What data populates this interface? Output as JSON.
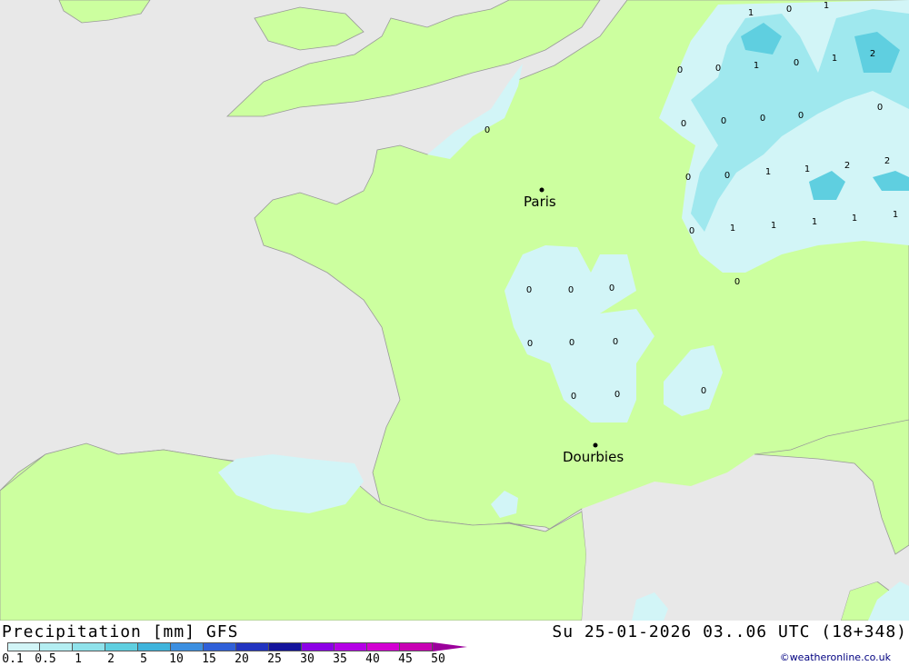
{
  "map": {
    "colors": {
      "sea": "#e8e8e8",
      "land": "#ccff9f",
      "precip_light": "#d2f5f7",
      "precip_mid": "#9fe8ee",
      "precip_heavy": "#5fcfe0",
      "border": "#999999"
    },
    "cities": [
      {
        "name": "Paris"
      },
      {
        "name": "Dourbies"
      }
    ],
    "values": [
      "1",
      "0",
      "1",
      "1",
      "0",
      "1",
      "0",
      "2",
      "0",
      "0",
      "0",
      "0",
      "0",
      "0",
      "0",
      "1",
      "1",
      "2",
      "2",
      "0",
      "1",
      "1",
      "1",
      "1",
      "1",
      "0",
      "0",
      "0",
      "0",
      "0",
      "0",
      "0",
      "0",
      "0",
      "0",
      "0",
      "0"
    ]
  },
  "footer": {
    "title_left": "Precipitation [mm] GFS",
    "title_right": "Su 25-01-2026 03..06 UTC (18+348)",
    "credit": "©weatheronline.co.uk",
    "scale": {
      "labels": [
        "0.1",
        "0.5",
        "1",
        "2",
        "5",
        "10",
        "15",
        "20",
        "25",
        "30",
        "35",
        "40",
        "45",
        "50"
      ],
      "colors": [
        "#d2f5f7",
        "#b4eef2",
        "#8fe2eb",
        "#5fcfe0",
        "#3fb4dc",
        "#3c8fe0",
        "#3060d8",
        "#2234c0",
        "#14149c",
        "#8c00e6",
        "#b400e6",
        "#d200d2",
        "#c800b4",
        "#9b009b"
      ]
    }
  }
}
